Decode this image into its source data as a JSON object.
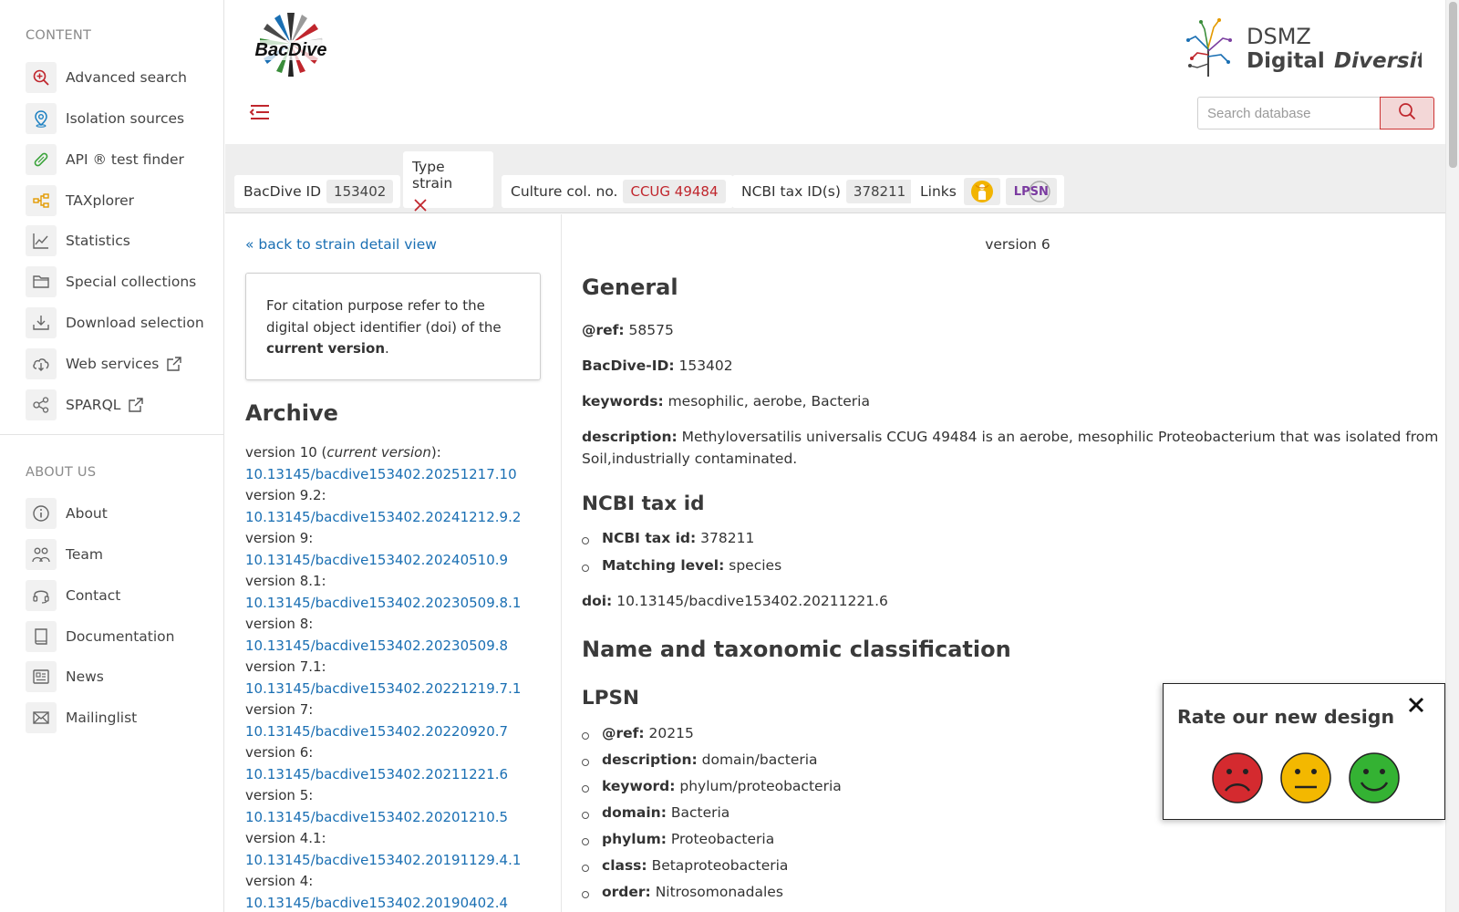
{
  "sidebar": {
    "content_heading": "CONTENT",
    "about_heading": "ABOUT US",
    "content_items": [
      {
        "label": "Advanced search",
        "icon": "zoom-in-icon"
      },
      {
        "label": "Isolation sources",
        "icon": "map-pin-icon"
      },
      {
        "label": "API ® test finder",
        "icon": "test-strip-icon"
      },
      {
        "label": "TAXplorer",
        "icon": "tree-structure-icon"
      },
      {
        "label": "Statistics",
        "icon": "line-chart-icon"
      },
      {
        "label": "Special collections",
        "icon": "folder-icon"
      },
      {
        "label": "Download selection",
        "icon": "download-tray-icon"
      },
      {
        "label": "Web services",
        "icon": "cloud-download-icon"
      },
      {
        "label": "SPARQL",
        "icon": "share-nodes-icon"
      }
    ],
    "about_items": [
      {
        "label": "About",
        "icon": "info-icon"
      },
      {
        "label": "Team",
        "icon": "team-icon"
      },
      {
        "label": "Contact",
        "icon": "headset-icon"
      },
      {
        "label": "Documentation",
        "icon": "book-icon"
      },
      {
        "label": "News",
        "icon": "newspaper-icon"
      },
      {
        "label": "Mailinglist",
        "icon": "envelope-icon"
      }
    ]
  },
  "header": {
    "logo_text": "BacDive",
    "dsmz_line1": "DSMZ",
    "dsmz_line2a": "Digital",
    "dsmz_line2b": "Diversity",
    "search_placeholder": "Search database"
  },
  "infobar": {
    "bacdive_id_label": "BacDive ID",
    "bacdive_id_value": "153402",
    "type_strain_label": "Type strain",
    "culture_label": "Culture col. no.",
    "culture_value": "CCUG 49484",
    "ncbi_label": "NCBI tax ID(s)",
    "ncbi_value": "378211",
    "links_label": "Links",
    "lpsn_badge": "LPSN"
  },
  "left": {
    "back_link": "« back to strain detail view",
    "citation_text_1": "For citation purpose refer to the digital object identifier (doi) of the ",
    "citation_bold": "current version",
    "citation_text_2": ".",
    "archive_title": "Archive",
    "current_prefix": "version 10 (",
    "current_italic": "current version",
    "current_suffix": "):",
    "archive": [
      {
        "version": "version 10 (current version):",
        "doi": "10.13145/bacdive153402.20251217.10"
      },
      {
        "version": "version 9.2:",
        "doi": "10.13145/bacdive153402.20241212.9.2"
      },
      {
        "version": "version 9:",
        "doi": "10.13145/bacdive153402.20240510.9"
      },
      {
        "version": "version 8.1:",
        "doi": "10.13145/bacdive153402.20230509.8.1"
      },
      {
        "version": "version 8:",
        "doi": "10.13145/bacdive153402.20230509.8"
      },
      {
        "version": "version 7.1:",
        "doi": "10.13145/bacdive153402.20221219.7.1"
      },
      {
        "version": "version 7:",
        "doi": "10.13145/bacdive153402.20220920.7"
      },
      {
        "version": "version 6:",
        "doi": "10.13145/bacdive153402.20211221.6"
      },
      {
        "version": "version 5:",
        "doi": "10.13145/bacdive153402.20201210.5"
      },
      {
        "version": "version 4.1:",
        "doi": "10.13145/bacdive153402.20191129.4.1"
      },
      {
        "version": "version 4:",
        "doi": "10.13145/bacdive153402.20190402.4"
      }
    ]
  },
  "main": {
    "version_label": "version 6",
    "general_title": "General",
    "ref_label": "@ref:",
    "ref_value": "58575",
    "bacdive_id_label": "BacDive-ID:",
    "bacdive_id_value": "153402",
    "keywords_label": "keywords:",
    "keywords_value": "mesophilic, aerobe, Bacteria",
    "description_label": "description:",
    "description_line1": "Methyloversatilis universalis CCUG 49484 is an aerobe, mesophilic Proteobacterium that was isolated from",
    "description_line2": "Soil,industrially contaminated.",
    "ncbi_title": "NCBI tax id",
    "ncbi_taxid_label": "NCBI tax id:",
    "ncbi_taxid_value": "378211",
    "matching_label": "Matching level:",
    "matching_value": "species",
    "doi_label": "doi:",
    "doi_value": "10.13145/bacdive153402.20211221.6",
    "taxonomy_title": "Name and taxonomic classification",
    "lpsn_title": "LPSN",
    "lpsn_items": [
      {
        "label": "@ref:",
        "value": "20215"
      },
      {
        "label": "description:",
        "value": "domain/bacteria"
      },
      {
        "label": "keyword:",
        "value": "phylum/proteobacteria"
      },
      {
        "label": "domain:",
        "value": "Bacteria"
      },
      {
        "label": "phylum:",
        "value": "Proteobacteria"
      },
      {
        "label": "class:",
        "value": "Betaproteobacteria"
      },
      {
        "label": "order:",
        "value": "Nitrosomonadales"
      }
    ]
  },
  "rating": {
    "title": "Rate our new design",
    "faces": [
      "sad-face-icon",
      "neutral-face-icon",
      "happy-face-icon"
    ]
  },
  "colors": {
    "accent_red": "#c0262d",
    "link_blue": "#1a6fb3",
    "sad": "#d42a2f",
    "neutral": "#f3b800",
    "happy": "#34b233"
  }
}
